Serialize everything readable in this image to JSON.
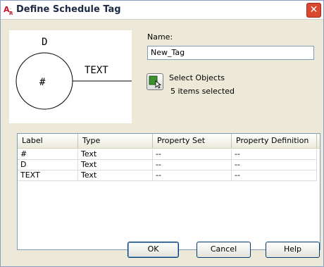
{
  "window": {
    "title": "Define Schedule Tag",
    "close_glyph": "✕"
  },
  "preview": {
    "top_label": "D",
    "side_label": "TEXT",
    "circle_label": "#"
  },
  "name": {
    "label": "Name:",
    "value": "New_Tag"
  },
  "select_objects": {
    "label": "Select Objects",
    "count_text": "5 items selected",
    "icon": "select-objects-icon"
  },
  "table": {
    "columns": [
      "Label",
      "Type",
      "Property Set",
      "Property Definition"
    ],
    "rows": [
      [
        "#",
        "Text",
        "--",
        "--"
      ],
      [
        "D",
        "Text",
        "--",
        "--"
      ],
      [
        "TEXT",
        "Text",
        "--",
        "--"
      ]
    ]
  },
  "buttons": {
    "ok": "OK",
    "cancel": "Cancel",
    "help": "Help"
  }
}
